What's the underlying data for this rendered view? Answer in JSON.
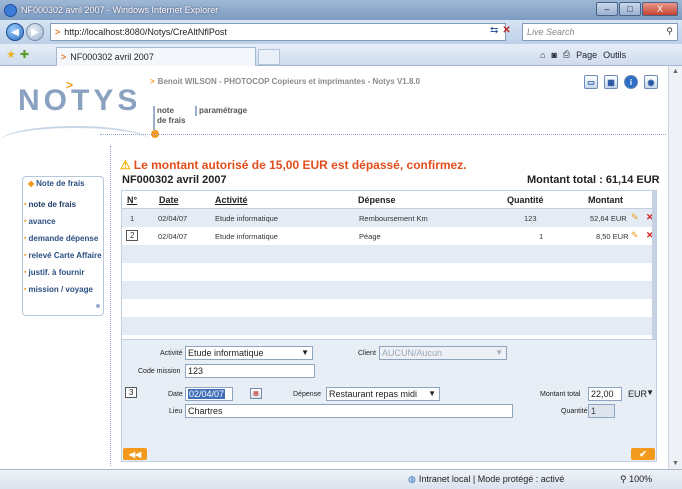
{
  "window": {
    "title": "NF000302 avril 2007 - Windows Internet Explorer",
    "min": "–",
    "max": "□",
    "close": "X"
  },
  "browser": {
    "url": "http://localhost:8080/Notys/CreAltNflPost",
    "search_placeholder": "Live Search",
    "tab_label": "NF000302 avril 2007",
    "cmd_page": "Page",
    "cmd_tools": "Outils",
    "status_zone": "Intranet local | Mode protégé : activé",
    "zoom": "100%"
  },
  "app": {
    "logo": "NOTYS",
    "breadcrumb": "Benoit WILSON - PHOTOCOP Copieurs et imprimantes - Notys V1.8.0",
    "tabs": {
      "note_line1": "note",
      "note_line2": "de frais",
      "param": "paramétrage"
    }
  },
  "sidebar": {
    "title": "Note de frais",
    "items": [
      {
        "label": "note de frais"
      },
      {
        "label": "avance"
      },
      {
        "label": "demande dépense"
      },
      {
        "label": "relevé Carte Affaire"
      },
      {
        "label": "justif. à fournir"
      },
      {
        "label": "mission / voyage"
      }
    ]
  },
  "main": {
    "warning": "Le montant autorisé de 15,00 EUR est dépassé, confirmez.",
    "note_title": "NF000302 avril 2007",
    "total": "Montant total : 61,14 EUR",
    "columns": {
      "num": "N°",
      "date": "Date",
      "activite": "Activité",
      "depense": "Dépense",
      "quantite": "Quantité",
      "montant": "Montant"
    },
    "rows": [
      {
        "num": "1",
        "date": "02/04/07",
        "activite": "Etude informatique",
        "depense": "Remboursement Km",
        "quantite": "123",
        "montant": "52,64 EUR"
      },
      {
        "num": "2",
        "date": "02/04/07",
        "activite": "Etude informatique",
        "depense": "Péage",
        "quantite": "1",
        "montant": "8,50 EUR"
      }
    ]
  },
  "form": {
    "activite_label": "Activité",
    "activite_value": "Etude informatique",
    "client_label": "Client",
    "client_value": "AUCUN/Aucun",
    "code_mission_label": "Code mission",
    "code_mission_value": "123",
    "line_number": "3",
    "date_label": "Date",
    "date_value": "02/04/07",
    "depense_label": "Dépense",
    "depense_value": "Restaurant repas midi",
    "montant_total_label": "Montant total",
    "montant_total_value": "22,00",
    "currency": "EUR",
    "lieu_label": "Lieu",
    "lieu_value": "Chartres",
    "quantite_label": "Quantité",
    "quantite_value": "1"
  },
  "colors": {
    "accent": "#f39a1e",
    "warning": "#e24d1b",
    "brand": "#2b4f82"
  }
}
